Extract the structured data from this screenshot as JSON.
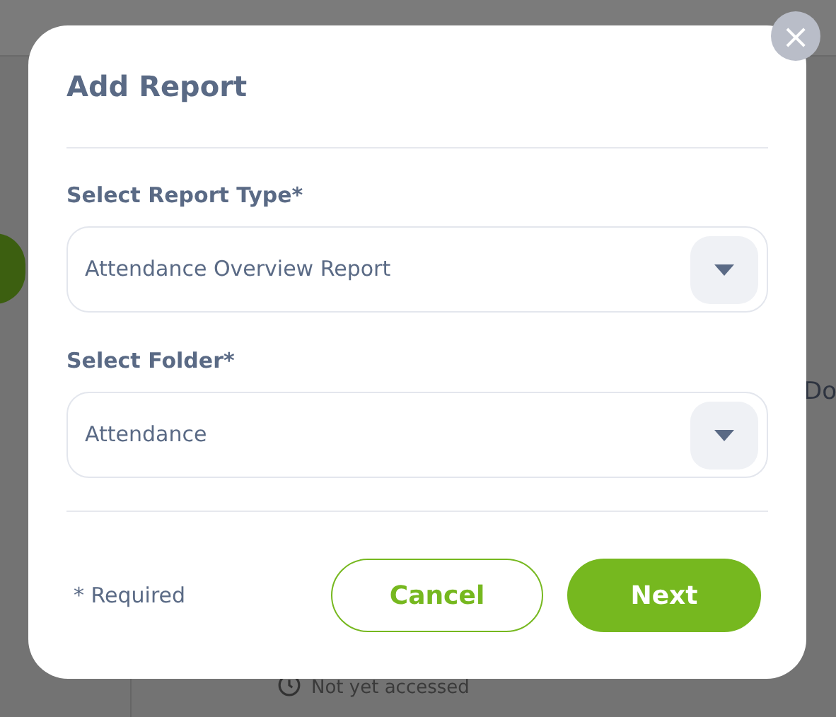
{
  "background": {
    "column_text": "Do",
    "access_note": "Not yet accessed"
  },
  "dialog": {
    "title": "Add Report",
    "close_label": "×",
    "fields": [
      {
        "label": "Select Report Type*",
        "value": "Attendance Overview Report"
      },
      {
        "label": "Select Folder*",
        "value": "Attendance"
      }
    ],
    "required_note": "* Required",
    "buttons": [
      {
        "label": "Cancel",
        "kind": "secondary"
      },
      {
        "label": "Next",
        "kind": "primary"
      }
    ]
  }
}
